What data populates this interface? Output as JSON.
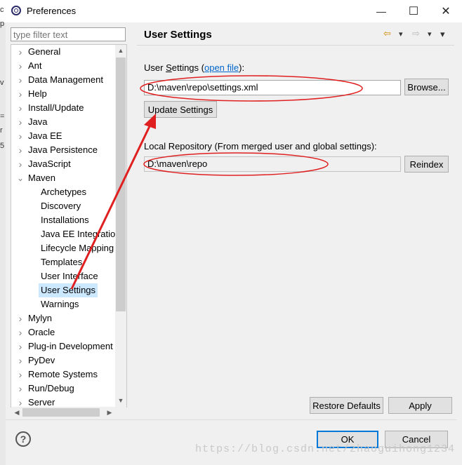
{
  "window": {
    "title": "Preferences",
    "minimize_glyph": "—",
    "maximize_glyph": "☐",
    "close_glyph": "✕",
    "icon": "eclipse-icon"
  },
  "filter": {
    "placeholder": "type filter text"
  },
  "tree": {
    "items": [
      {
        "label": "General",
        "expander": "›"
      },
      {
        "label": "Ant",
        "expander": "›"
      },
      {
        "label": "Data Management",
        "expander": "›"
      },
      {
        "label": "Help",
        "expander": "›"
      },
      {
        "label": "Install/Update",
        "expander": "›"
      },
      {
        "label": "Java",
        "expander": "›"
      },
      {
        "label": "Java EE",
        "expander": "›"
      },
      {
        "label": "Java Persistence",
        "expander": "›"
      },
      {
        "label": "JavaScript",
        "expander": "›"
      },
      {
        "label": "Maven",
        "expander": "⌄"
      },
      {
        "label": "Archetypes"
      },
      {
        "label": "Discovery"
      },
      {
        "label": "Installations"
      },
      {
        "label": "Java EE Integration"
      },
      {
        "label": "Lifecycle Mapping"
      },
      {
        "label": "Templates"
      },
      {
        "label": "User Interface"
      },
      {
        "label": "User Settings"
      },
      {
        "label": "Warnings"
      },
      {
        "label": "Mylyn",
        "expander": "›"
      },
      {
        "label": "Oracle",
        "expander": "›"
      },
      {
        "label": "Plug-in Development",
        "expander": "›"
      },
      {
        "label": "PyDev",
        "expander": "›"
      },
      {
        "label": "Remote Systems",
        "expander": "›"
      },
      {
        "label": "Run/Debug",
        "expander": "›"
      },
      {
        "label": "Server",
        "expander": "›"
      }
    ],
    "selected_label": "User Settings"
  },
  "scroll": {
    "up": "▲",
    "down": "▼",
    "left": "◀",
    "right": "▶"
  },
  "panel": {
    "title": "User Settings",
    "nav": {
      "back": "⇦",
      "forward": "⇨",
      "dropdown": "▾",
      "menu": "▾"
    },
    "user_settings_label_prefix": "User ",
    "user_settings_label_underlined": "S",
    "user_settings_label_rest": "ettings (",
    "open_file_link": "open file",
    "user_settings_label_suffix": "):",
    "user_settings_value": "D:\\maven\\repo\\settings.xml",
    "browse_button": "Browse...",
    "update_button": "Update Settings",
    "local_repo_label": "Local Repository (From merged user and global settings):",
    "local_repo_value": "D:\\maven\\repo",
    "reindex_button": "Reindex",
    "restore_defaults_button": "Restore Defaults",
    "apply_button": "Apply"
  },
  "footer": {
    "help_glyph": "?",
    "ok_button": "OK",
    "cancel_button": "Cancel"
  },
  "watermark": "https://blog.csdn.net/zhaoguihong1234",
  "annotation_color": "#e02020",
  "behind_window_chars": [
    "c",
    "p",
    "v",
    "=",
    "r",
    "5"
  ]
}
